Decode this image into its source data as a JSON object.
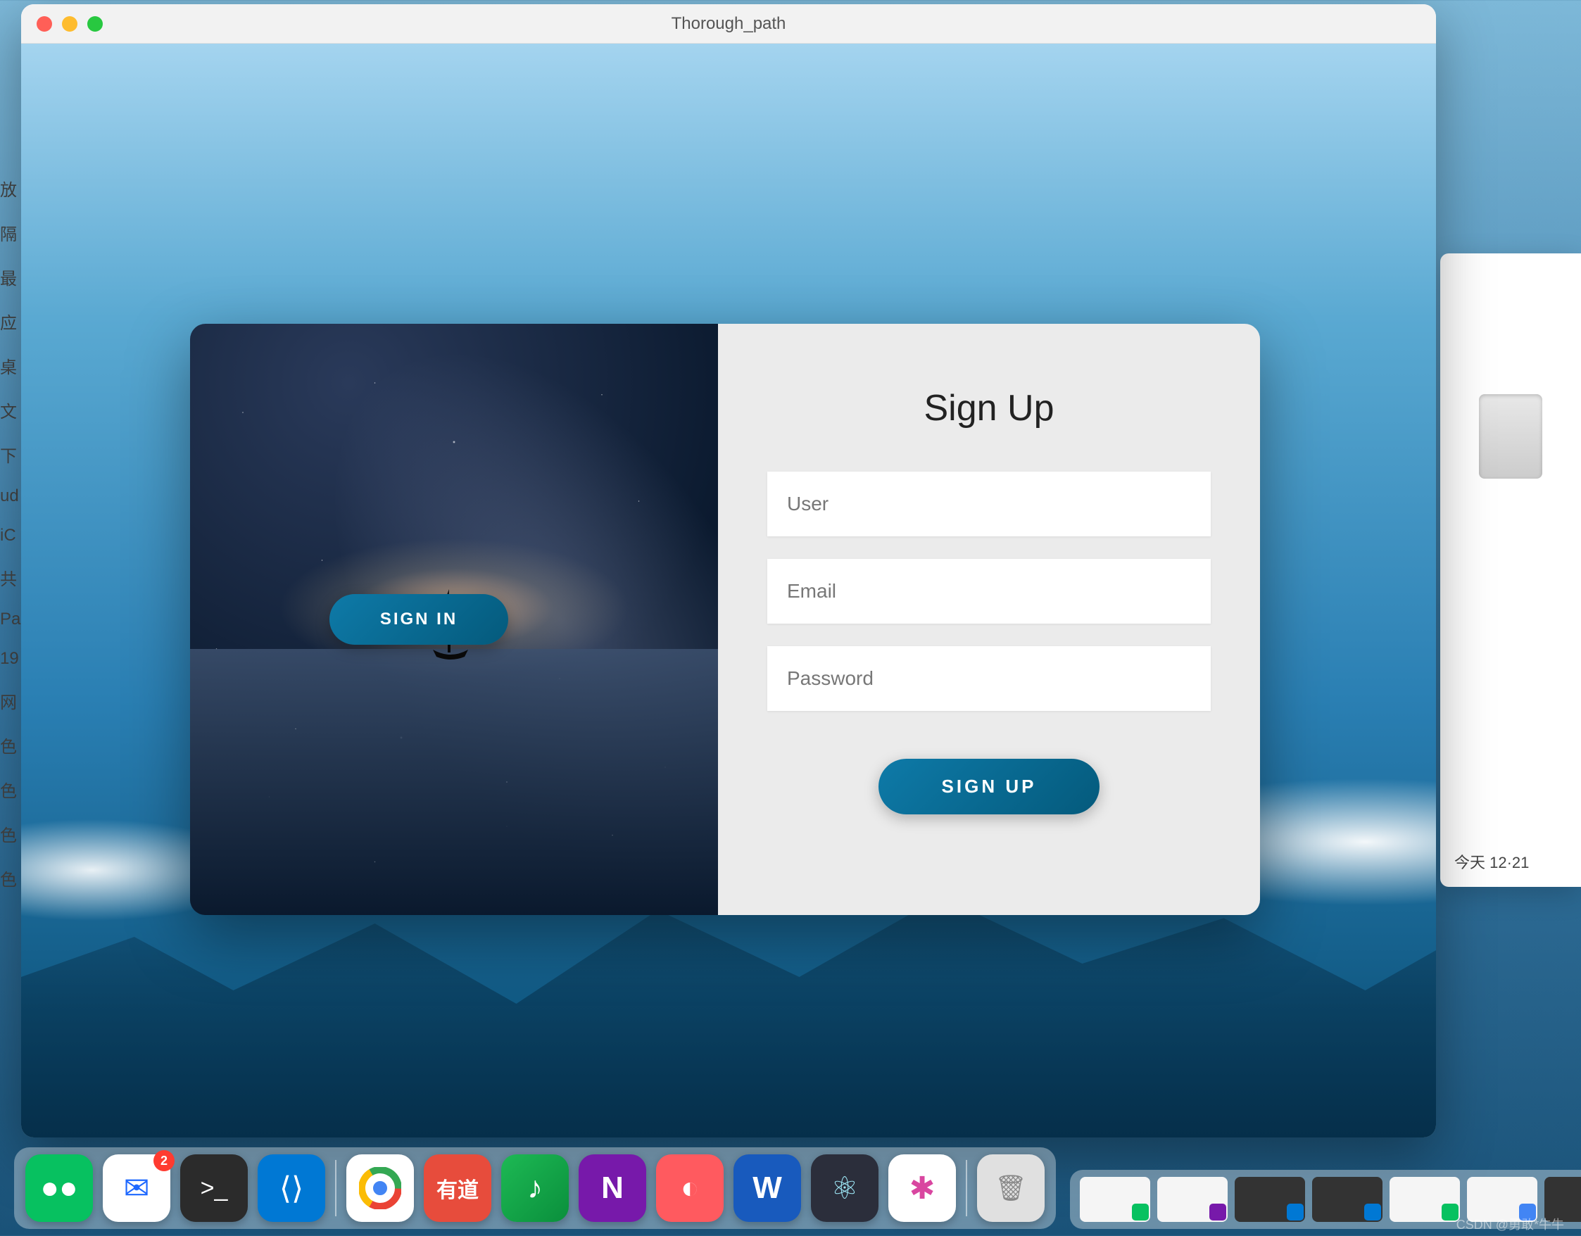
{
  "window": {
    "title": "Thorough_path"
  },
  "card": {
    "sign_in_label": "SIGN IN",
    "sign_up_title": "Sign Up",
    "fields": {
      "user_placeholder": "User",
      "email_placeholder": "Email",
      "password_placeholder": "Password"
    },
    "sign_up_label": "SIGN UP"
  },
  "colors": {
    "button_gradient_start": "#0e7aa8",
    "button_gradient_end": "#045a7c",
    "card_right_bg": "#ebebeb"
  },
  "bg_sidebar_items": [
    "放",
    "隔",
    "最",
    "应",
    "桌",
    "文",
    "下",
    "ud",
    "iC",
    "共",
    "Pa",
    "19",
    "网",
    "色",
    "色",
    "色",
    "色"
  ],
  "bg_finder": {
    "time_label": "今天 12·21"
  },
  "dock": {
    "apps": [
      {
        "name": "wechat",
        "color": "#07c160",
        "glyph": "●●"
      },
      {
        "name": "mail",
        "color": "#ffffff",
        "glyph": "✉",
        "badge": "2"
      },
      {
        "name": "terminal",
        "color": "#2b2b2b",
        "glyph": ">_"
      },
      {
        "name": "vscode",
        "color": "#0078d4",
        "glyph": "⟨⟩"
      }
    ],
    "apps2": [
      {
        "name": "chrome",
        "color": "#ffffff",
        "glyph": "◉"
      },
      {
        "name": "youdao",
        "color": "#e74c3c",
        "glyph": "有道"
      },
      {
        "name": "music",
        "color": "#1db954",
        "glyph": "♪"
      },
      {
        "name": "onenote",
        "color": "#7719aa",
        "glyph": "N"
      },
      {
        "name": "redapp",
        "color": "#ff5a5f",
        "glyph": "◐"
      },
      {
        "name": "word",
        "color": "#185abd",
        "glyph": "W"
      },
      {
        "name": "electron",
        "color": "#2b2e3b",
        "glyph": "⚛"
      },
      {
        "name": "pinkapp",
        "color": "#ffffff",
        "glyph": "✱"
      }
    ],
    "trash": {
      "name": "trash",
      "color": "#d0d0d0",
      "glyph": "🗑"
    }
  },
  "watermark": "CSDN @勇敢*牛牛"
}
